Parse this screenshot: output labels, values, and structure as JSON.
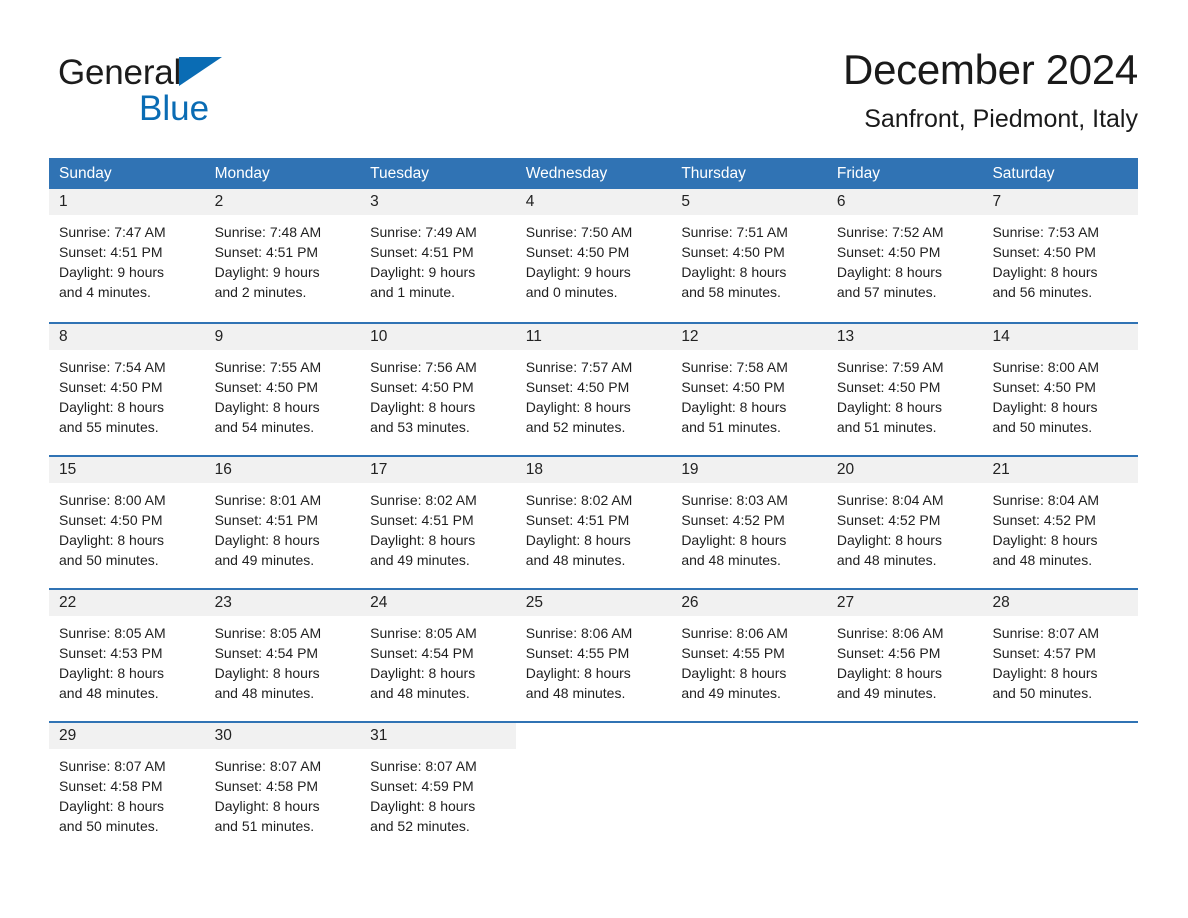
{
  "brand": {
    "word1": "General",
    "word2": "Blue",
    "triangle_color": "#0a6cb4",
    "text_color": "#1c1c1c"
  },
  "header": {
    "month_title": "December 2024",
    "location": "Sanfront, Piedmont, Italy"
  },
  "theme": {
    "header_blue": "#3073b4",
    "daynum_band": "#f1f1f1",
    "page_background": "#ffffff",
    "text": "#1a1a1a"
  },
  "calendar": {
    "weekdays": [
      "Sunday",
      "Monday",
      "Tuesday",
      "Wednesday",
      "Thursday",
      "Friday",
      "Saturday"
    ],
    "weeks": [
      [
        {
          "day": "1",
          "sunrise": "Sunrise: 7:47 AM",
          "sunset": "Sunset: 4:51 PM",
          "daylight1": "Daylight: 9 hours",
          "daylight2": "and 4 minutes."
        },
        {
          "day": "2",
          "sunrise": "Sunrise: 7:48 AM",
          "sunset": "Sunset: 4:51 PM",
          "daylight1": "Daylight: 9 hours",
          "daylight2": "and 2 minutes."
        },
        {
          "day": "3",
          "sunrise": "Sunrise: 7:49 AM",
          "sunset": "Sunset: 4:51 PM",
          "daylight1": "Daylight: 9 hours",
          "daylight2": "and 1 minute."
        },
        {
          "day": "4",
          "sunrise": "Sunrise: 7:50 AM",
          "sunset": "Sunset: 4:50 PM",
          "daylight1": "Daylight: 9 hours",
          "daylight2": "and 0 minutes."
        },
        {
          "day": "5",
          "sunrise": "Sunrise: 7:51 AM",
          "sunset": "Sunset: 4:50 PM",
          "daylight1": "Daylight: 8 hours",
          "daylight2": "and 58 minutes."
        },
        {
          "day": "6",
          "sunrise": "Sunrise: 7:52 AM",
          "sunset": "Sunset: 4:50 PM",
          "daylight1": "Daylight: 8 hours",
          "daylight2": "and 57 minutes."
        },
        {
          "day": "7",
          "sunrise": "Sunrise: 7:53 AM",
          "sunset": "Sunset: 4:50 PM",
          "daylight1": "Daylight: 8 hours",
          "daylight2": "and 56 minutes."
        }
      ],
      [
        {
          "day": "8",
          "sunrise": "Sunrise: 7:54 AM",
          "sunset": "Sunset: 4:50 PM",
          "daylight1": "Daylight: 8 hours",
          "daylight2": "and 55 minutes."
        },
        {
          "day": "9",
          "sunrise": "Sunrise: 7:55 AM",
          "sunset": "Sunset: 4:50 PM",
          "daylight1": "Daylight: 8 hours",
          "daylight2": "and 54 minutes."
        },
        {
          "day": "10",
          "sunrise": "Sunrise: 7:56 AM",
          "sunset": "Sunset: 4:50 PM",
          "daylight1": "Daylight: 8 hours",
          "daylight2": "and 53 minutes."
        },
        {
          "day": "11",
          "sunrise": "Sunrise: 7:57 AM",
          "sunset": "Sunset: 4:50 PM",
          "daylight1": "Daylight: 8 hours",
          "daylight2": "and 52 minutes."
        },
        {
          "day": "12",
          "sunrise": "Sunrise: 7:58 AM",
          "sunset": "Sunset: 4:50 PM",
          "daylight1": "Daylight: 8 hours",
          "daylight2": "and 51 minutes."
        },
        {
          "day": "13",
          "sunrise": "Sunrise: 7:59 AM",
          "sunset": "Sunset: 4:50 PM",
          "daylight1": "Daylight: 8 hours",
          "daylight2": "and 51 minutes."
        },
        {
          "day": "14",
          "sunrise": "Sunrise: 8:00 AM",
          "sunset": "Sunset: 4:50 PM",
          "daylight1": "Daylight: 8 hours",
          "daylight2": "and 50 minutes."
        }
      ],
      [
        {
          "day": "15",
          "sunrise": "Sunrise: 8:00 AM",
          "sunset": "Sunset: 4:50 PM",
          "daylight1": "Daylight: 8 hours",
          "daylight2": "and 50 minutes."
        },
        {
          "day": "16",
          "sunrise": "Sunrise: 8:01 AM",
          "sunset": "Sunset: 4:51 PM",
          "daylight1": "Daylight: 8 hours",
          "daylight2": "and 49 minutes."
        },
        {
          "day": "17",
          "sunrise": "Sunrise: 8:02 AM",
          "sunset": "Sunset: 4:51 PM",
          "daylight1": "Daylight: 8 hours",
          "daylight2": "and 49 minutes."
        },
        {
          "day": "18",
          "sunrise": "Sunrise: 8:02 AM",
          "sunset": "Sunset: 4:51 PM",
          "daylight1": "Daylight: 8 hours",
          "daylight2": "and 48 minutes."
        },
        {
          "day": "19",
          "sunrise": "Sunrise: 8:03 AM",
          "sunset": "Sunset: 4:52 PM",
          "daylight1": "Daylight: 8 hours",
          "daylight2": "and 48 minutes."
        },
        {
          "day": "20",
          "sunrise": "Sunrise: 8:04 AM",
          "sunset": "Sunset: 4:52 PM",
          "daylight1": "Daylight: 8 hours",
          "daylight2": "and 48 minutes."
        },
        {
          "day": "21",
          "sunrise": "Sunrise: 8:04 AM",
          "sunset": "Sunset: 4:52 PM",
          "daylight1": "Daylight: 8 hours",
          "daylight2": "and 48 minutes."
        }
      ],
      [
        {
          "day": "22",
          "sunrise": "Sunrise: 8:05 AM",
          "sunset": "Sunset: 4:53 PM",
          "daylight1": "Daylight: 8 hours",
          "daylight2": "and 48 minutes."
        },
        {
          "day": "23",
          "sunrise": "Sunrise: 8:05 AM",
          "sunset": "Sunset: 4:54 PM",
          "daylight1": "Daylight: 8 hours",
          "daylight2": "and 48 minutes."
        },
        {
          "day": "24",
          "sunrise": "Sunrise: 8:05 AM",
          "sunset": "Sunset: 4:54 PM",
          "daylight1": "Daylight: 8 hours",
          "daylight2": "and 48 minutes."
        },
        {
          "day": "25",
          "sunrise": "Sunrise: 8:06 AM",
          "sunset": "Sunset: 4:55 PM",
          "daylight1": "Daylight: 8 hours",
          "daylight2": "and 48 minutes."
        },
        {
          "day": "26",
          "sunrise": "Sunrise: 8:06 AM",
          "sunset": "Sunset: 4:55 PM",
          "daylight1": "Daylight: 8 hours",
          "daylight2": "and 49 minutes."
        },
        {
          "day": "27",
          "sunrise": "Sunrise: 8:06 AM",
          "sunset": "Sunset: 4:56 PM",
          "daylight1": "Daylight: 8 hours",
          "daylight2": "and 49 minutes."
        },
        {
          "day": "28",
          "sunrise": "Sunrise: 8:07 AM",
          "sunset": "Sunset: 4:57 PM",
          "daylight1": "Daylight: 8 hours",
          "daylight2": "and 50 minutes."
        }
      ],
      [
        {
          "day": "29",
          "sunrise": "Sunrise: 8:07 AM",
          "sunset": "Sunset: 4:58 PM",
          "daylight1": "Daylight: 8 hours",
          "daylight2": "and 50 minutes."
        },
        {
          "day": "30",
          "sunrise": "Sunrise: 8:07 AM",
          "sunset": "Sunset: 4:58 PM",
          "daylight1": "Daylight: 8 hours",
          "daylight2": "and 51 minutes."
        },
        {
          "day": "31",
          "sunrise": "Sunrise: 8:07 AM",
          "sunset": "Sunset: 4:59 PM",
          "daylight1": "Daylight: 8 hours",
          "daylight2": "and 52 minutes."
        },
        {
          "day": "",
          "sunrise": "",
          "sunset": "",
          "daylight1": "",
          "daylight2": ""
        },
        {
          "day": "",
          "sunrise": "",
          "sunset": "",
          "daylight1": "",
          "daylight2": ""
        },
        {
          "day": "",
          "sunrise": "",
          "sunset": "",
          "daylight1": "",
          "daylight2": ""
        },
        {
          "day": "",
          "sunrise": "",
          "sunset": "",
          "daylight1": "",
          "daylight2": ""
        }
      ]
    ]
  }
}
